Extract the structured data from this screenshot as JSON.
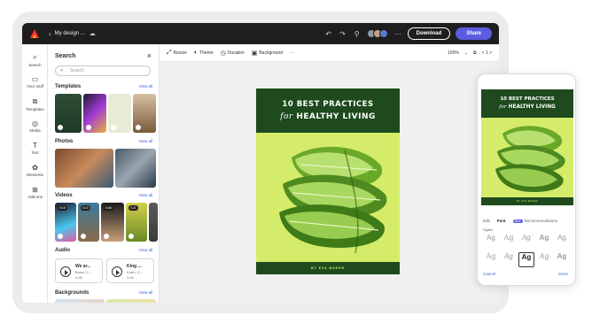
{
  "topbar": {
    "doc_name": "My design ...",
    "download_label": "Download",
    "share_label": "Share",
    "more_label": "···"
  },
  "rail": {
    "items": [
      {
        "label": "Search",
        "icon": "search-icon"
      },
      {
        "label": "Your stuff",
        "icon": "folder-icon"
      },
      {
        "label": "Templates",
        "icon": "templates-icon"
      },
      {
        "label": "Media",
        "icon": "media-icon"
      },
      {
        "label": "Text",
        "icon": "text-icon"
      },
      {
        "label": "Elements",
        "icon": "elements-icon"
      },
      {
        "label": "Add-ons",
        "icon": "addons-icon"
      }
    ]
  },
  "panel": {
    "title": "Search",
    "search_placeholder": "Search",
    "view_all": "View all",
    "sections": {
      "templates": "Templates",
      "photos": "Photos",
      "videos": "Videos",
      "audio": "Audio",
      "backgrounds": "Backgrounds"
    },
    "video_badges": [
      "0:15",
      "0:10",
      "0:06",
      "0:21"
    ],
    "audio_items": [
      {
        "title": "We ar...",
        "artist": "Bossi, C...",
        "duration": "4:35"
      },
      {
        "title": "King ...",
        "artist": "Kurth, C...",
        "duration": "3:24"
      }
    ]
  },
  "toolbar": {
    "resize": "Resize",
    "theme": "Theme",
    "duration": "Duration",
    "background": "Background",
    "more": "···",
    "zoom": "100%",
    "page_nav": "<  1  >"
  },
  "poster": {
    "line1": "10 BEST PRACTICES",
    "line2_for": "for",
    "line2_rest": "HEALTHY LIVING",
    "byline": "BY EVA BAKER"
  },
  "phone": {
    "tabs": {
      "edit": "Edit",
      "font": "Font",
      "pill": "New",
      "more": "Recommendations"
    },
    "styles_label": "Styles",
    "style_sample": "Ag",
    "cancel": "Cancel",
    "done": "Done"
  },
  "colors": {
    "poster_green": "#1e4a1e",
    "poster_lime": "#d4ec6a",
    "accent": "#5c5ce0"
  }
}
